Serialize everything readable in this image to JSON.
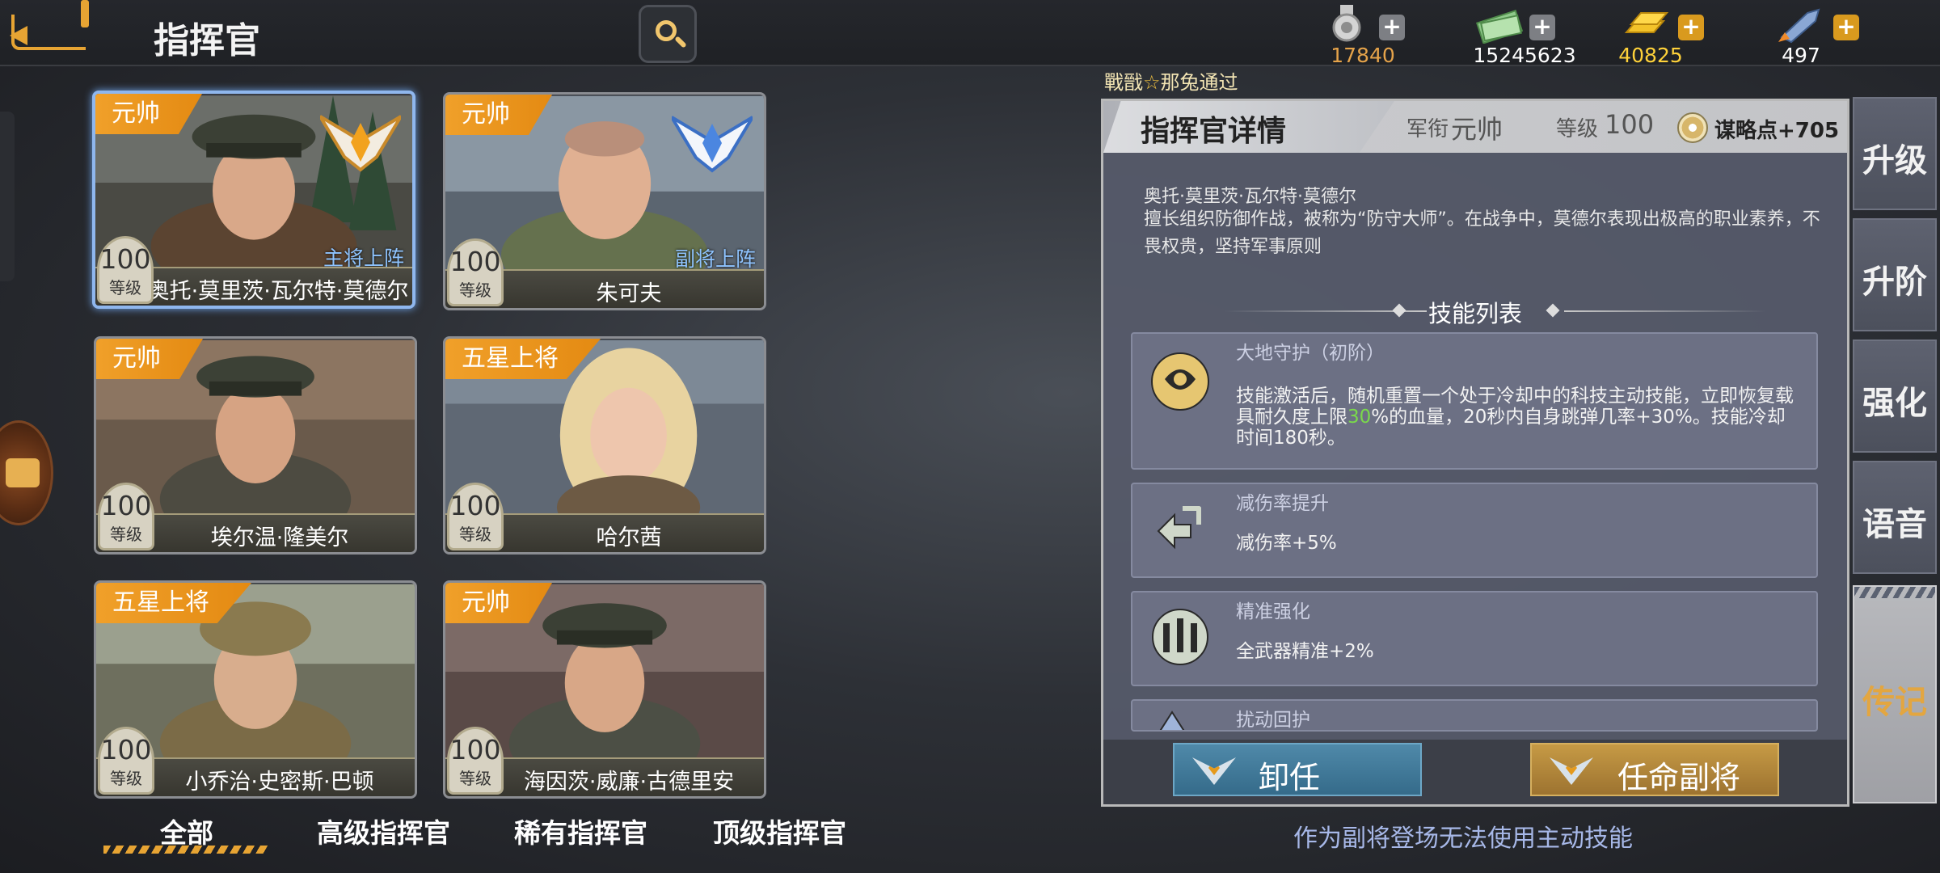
{
  "header": {
    "title": "指挥官",
    "resources": [
      {
        "icon": "medal-icon",
        "value": "17840",
        "color": "#e5a34a"
      },
      {
        "icon": "cash-icon",
        "value": "15245623",
        "color": "#ffffff"
      },
      {
        "icon": "gold-bar-icon",
        "value": "40825",
        "color": "#ffd23a"
      },
      {
        "icon": "rocket-icon",
        "value": "497",
        "color": "#ffffff"
      }
    ],
    "plus_label": "+"
  },
  "marquee": {
    "part1": "戰戩",
    "star": "☆",
    "part2": "那兔通过"
  },
  "commanders": [
    {
      "rank": "元帅",
      "name": "奥托·莫里茨·瓦尔特·莫德尔",
      "level": "100",
      "level_label": "等级",
      "deploy": "主将上阵",
      "emblem": "gold-wing-emblem-icon",
      "selected": true
    },
    {
      "rank": "元帅",
      "name": "朱可夫",
      "level": "100",
      "level_label": "等级",
      "deploy": "副将上阵",
      "emblem": "blue-wing-emblem-icon"
    },
    {
      "rank": "元帅",
      "name": "埃尔温·隆美尔",
      "level": "100",
      "level_label": "等级"
    },
    {
      "rank": "五星上将",
      "name": "哈尔茜",
      "level": "100",
      "level_label": "等级"
    },
    {
      "rank": "五星上将",
      "name": "小乔治·史密斯·巴顿",
      "level": "100",
      "level_label": "等级"
    },
    {
      "rank": "元帅",
      "name": "海因茨·威廉·古德里安",
      "level": "100",
      "level_label": "等级"
    }
  ],
  "filter_tabs": [
    "全部",
    "高级指挥官",
    "稀有指挥官",
    "顶级指挥官"
  ],
  "detail": {
    "title": "指挥官详情",
    "rank_label": "军衔",
    "rank_value": "元帅",
    "level_label": "等级",
    "level_value": "100",
    "strategy": "谋略点+705",
    "name": "奥托·莫里茨·瓦尔特·莫德尔",
    "description": "擅长组织防御作战，被称为“防守大师”。在战争中，莫德尔表现出极高的职业素养，不畏权贵，坚持军事原则",
    "skills_title": "技能列表",
    "skills": [
      {
        "name": "大地守护（初阶）",
        "desc_a": "技能激活后，随机重置一个处于冷却中的科技主动技能，立即恢复载具耐久度上限",
        "highlight": "30",
        "desc_b": "%的血量，20秒内自身跳弹几率+30%。技能冷却时间180秒。",
        "icon": "earth-guard-icon"
      },
      {
        "name": "减伤率提升",
        "desc": "减伤率+5%",
        "icon": "damage-reduction-icon"
      },
      {
        "name": "精准强化",
        "desc": "全武器精准+2%",
        "icon": "precision-icon"
      },
      {
        "name": "扰动回护",
        "icon": "disturbance-guard-icon"
      }
    ],
    "dismiss_label": "卸任",
    "appoint_label": "任命副将",
    "note": "作为副将登场无法使用主动技能"
  },
  "side_tabs": [
    "升级",
    "升阶",
    "强化",
    "语音",
    "传记"
  ],
  "active_side_tab": "传记"
}
